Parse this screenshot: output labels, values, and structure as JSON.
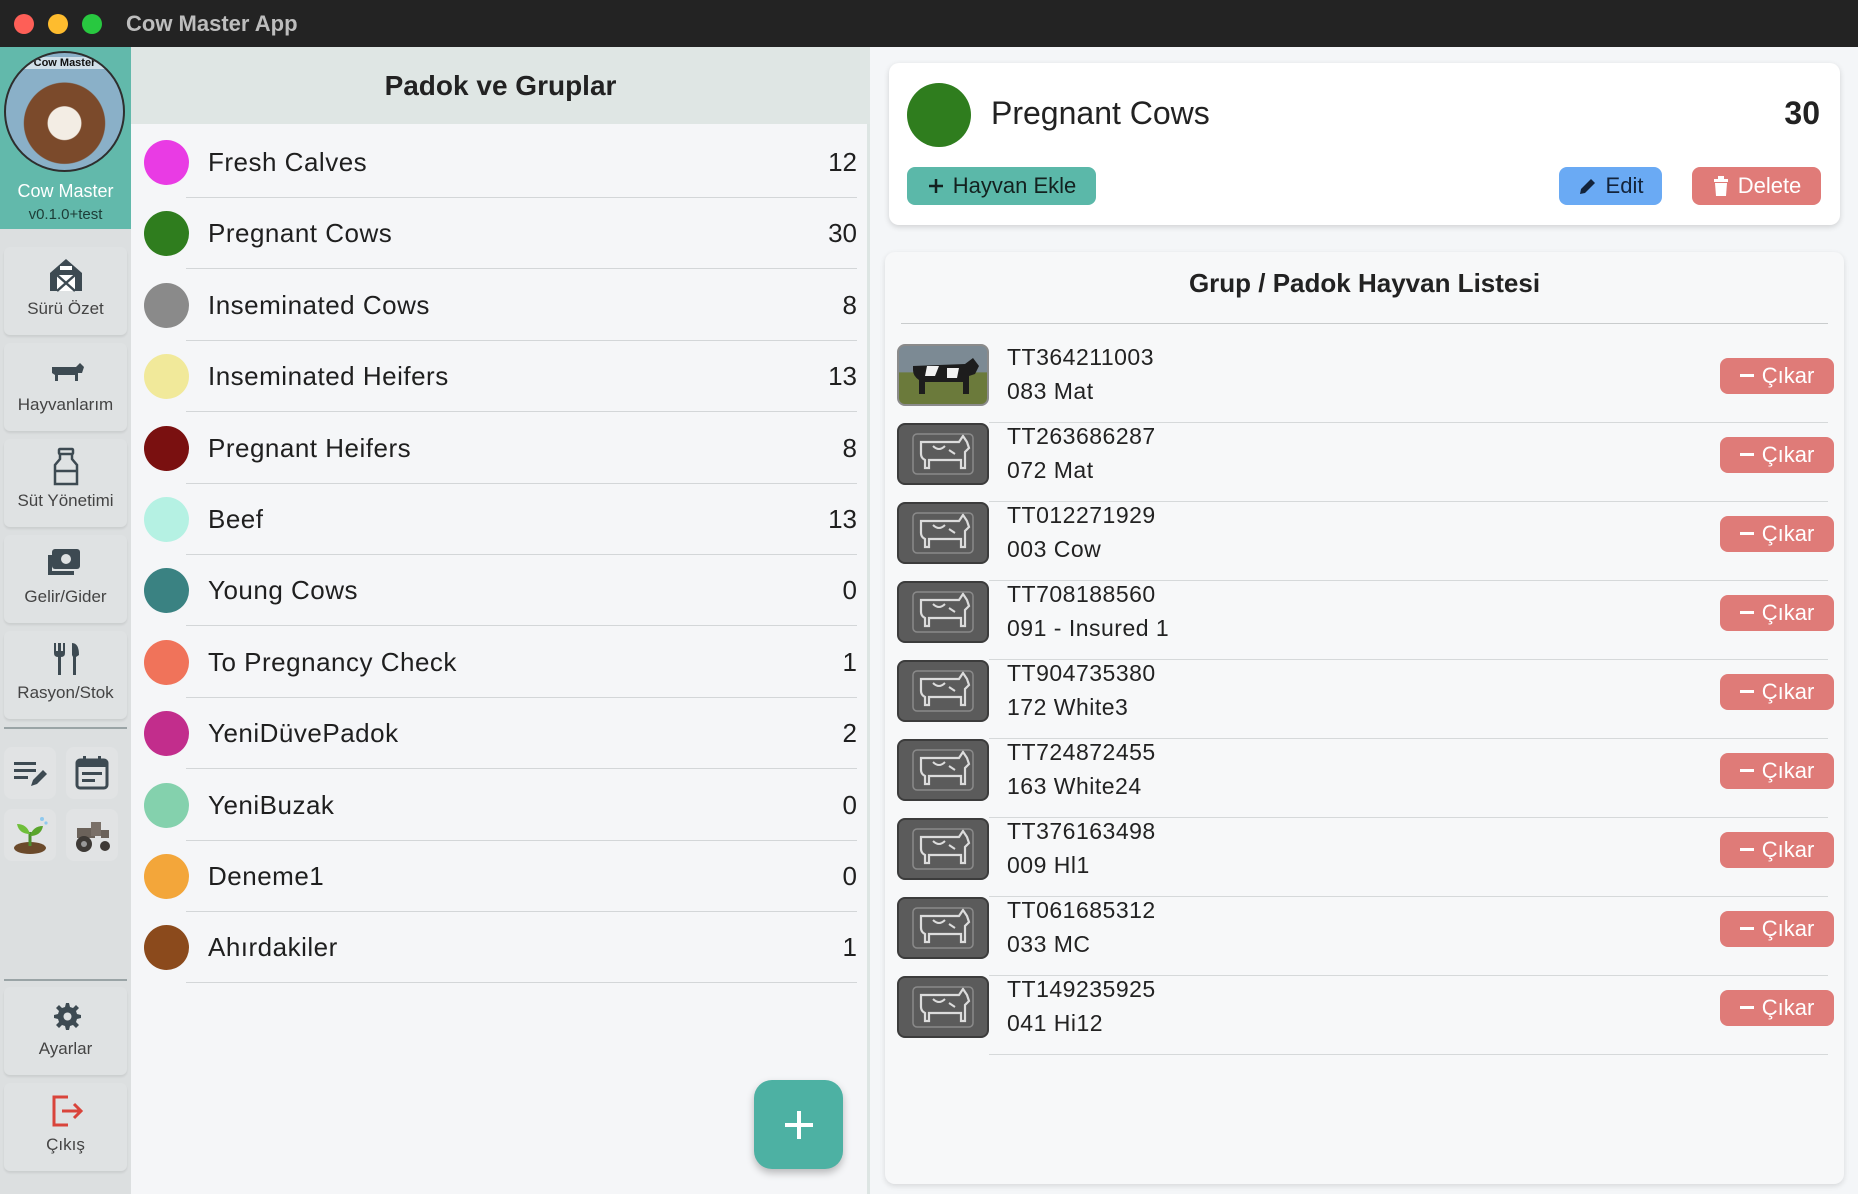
{
  "window": {
    "title": "Cow Master App"
  },
  "brand": {
    "logo_text": "Cow Master",
    "name": "Cow Master",
    "version": "v0.1.0+test"
  },
  "nav": {
    "items": [
      {
        "label": "Sürü Özet",
        "icon": "barn-icon"
      },
      {
        "label": "Hayvanlarım",
        "icon": "cow-icon"
      },
      {
        "label": "Süt Yönetimi",
        "icon": "milk-can-icon"
      },
      {
        "label": "Gelir/Gider",
        "icon": "money-icon"
      },
      {
        "label": "Rasyon/Stok",
        "icon": "fork-knife-icon"
      }
    ],
    "mini_icons": [
      "notes-edit-icon",
      "calendar-icon",
      "sprout-icon",
      "tractor-icon"
    ],
    "settings_label": "Ayarlar",
    "logout_label": "Çıkış"
  },
  "groups_panel": {
    "title": "Padok ve Gruplar",
    "groups": [
      {
        "name": "Fresh Calves",
        "count": "12",
        "color": "#e93be4"
      },
      {
        "name": "Pregnant Cows",
        "count": "30",
        "color": "#2f7d1e"
      },
      {
        "name": "Inseminated Cows",
        "count": "8",
        "color": "#8a8a8a"
      },
      {
        "name": "Inseminated Heifers",
        "count": "13",
        "color": "#f1e99a"
      },
      {
        "name": "Pregnant Heifers",
        "count": "8",
        "color": "#7a1010"
      },
      {
        "name": "Beef",
        "count": "13",
        "color": "#b5f1e3"
      },
      {
        "name": "Young Cows",
        "count": "0",
        "color": "#3a8282"
      },
      {
        "name": "To Pregnancy Check",
        "count": "1",
        "color": "#f0735a"
      },
      {
        "name": "YeniDüvePadok",
        "count": "2",
        "color": "#c22d8c"
      },
      {
        "name": "YeniBuzak",
        "count": "0",
        "color": "#84d1ad"
      },
      {
        "name": "Deneme1",
        "count": "0",
        "color": "#f3a63a"
      },
      {
        "name": "Ahırdakiler",
        "count": "1",
        "color": "#8b4a1c"
      }
    ],
    "add_icon": "plus-icon"
  },
  "detail": {
    "name": "Pregnant Cows",
    "count": "30",
    "color": "#2f7d1e",
    "add_animal_label": "Hayvan Ekle",
    "edit_label": "Edit",
    "delete_label": "Delete"
  },
  "animal_list": {
    "title": "Grup / Padok Hayvan Listesi",
    "remove_label": "Çıkar",
    "animals": [
      {
        "tag": "TT364211003",
        "name": "083 Mat",
        "has_photo": true
      },
      {
        "tag": "TT263686287",
        "name": "072 Mat",
        "has_photo": false
      },
      {
        "tag": "TT012271929",
        "name": "003 Cow",
        "has_photo": false
      },
      {
        "tag": "TT708188560",
        "name": "091 - Insured 1",
        "has_photo": false
      },
      {
        "tag": "TT904735380",
        "name": "172 White3",
        "has_photo": false
      },
      {
        "tag": "TT724872455",
        "name": "163 White24",
        "has_photo": false
      },
      {
        "tag": "TT376163498",
        "name": "009 Hl1",
        "has_photo": false
      },
      {
        "tag": "TT061685312",
        "name": "033 MC",
        "has_photo": false
      },
      {
        "tag": "TT149235925",
        "name": "041 Hi12",
        "has_photo": false
      }
    ]
  }
}
